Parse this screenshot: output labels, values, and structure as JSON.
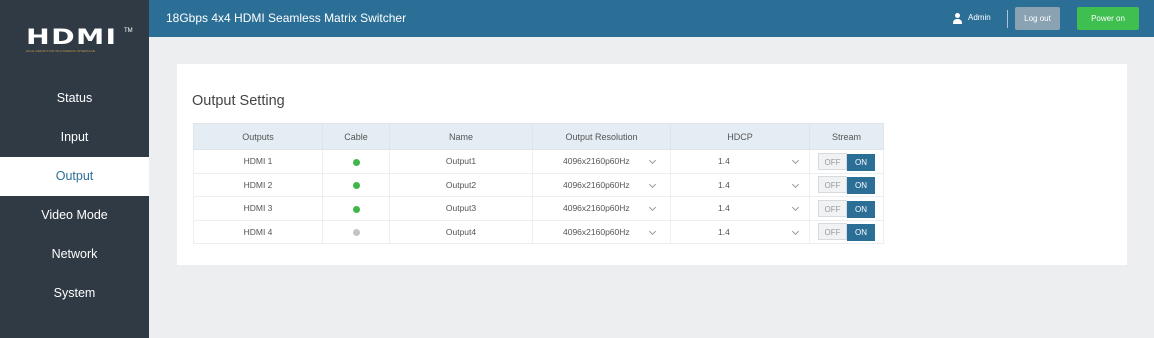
{
  "app": {
    "title": "18Gbps 4x4 HDMI Seamless Matrix Switcher",
    "logo_text": "HDMI",
    "logo_tm": "TM",
    "logo_sub": "HIGH-DEFINITION MULTIMEDIA INTERFACE"
  },
  "header": {
    "user_icon": "user-icon",
    "user_name": "Admin",
    "logout_label": "Log out",
    "power_label": "Power on",
    "colors": {
      "bar": "#2b6f97",
      "power": "#3fbf4f",
      "logout": "#8aa3b3"
    }
  },
  "sidebar": {
    "active": "Output",
    "items": [
      {
        "label": "Status"
      },
      {
        "label": "Input"
      },
      {
        "label": "Output"
      },
      {
        "label": "Video Mode"
      },
      {
        "label": "Network"
      },
      {
        "label": "System"
      }
    ]
  },
  "main": {
    "section_title": "Output Setting",
    "columns": [
      "Outputs",
      "Cable",
      "Name",
      "Output Resolution",
      "HDCP",
      "Stream"
    ],
    "rows": [
      {
        "output": "HDMI 1",
        "cable": "connected",
        "cable_color": "#3fb54a",
        "name": "Output1",
        "resolution": "4096x2160p60Hz",
        "hdcp": "1.4",
        "stream_off": "OFF",
        "stream_on": "ON",
        "stream_state": "ON"
      },
      {
        "output": "HDMI 2",
        "cable": "connected",
        "cable_color": "#3fb54a",
        "name": "Output2",
        "resolution": "4096x2160p60Hz",
        "hdcp": "1.4",
        "stream_off": "OFF",
        "stream_on": "ON",
        "stream_state": "ON"
      },
      {
        "output": "HDMI 3",
        "cable": "connected",
        "cable_color": "#3fb54a",
        "name": "Output3",
        "resolution": "4096x2160p60Hz",
        "hdcp": "1.4",
        "stream_off": "OFF",
        "stream_on": "ON",
        "stream_state": "ON"
      },
      {
        "output": "HDMI 4",
        "cable": "disconnected",
        "cable_color": "#c4c4c4",
        "name": "Output4",
        "resolution": "4096x2160p60Hz",
        "hdcp": "1.4",
        "stream_off": "OFF",
        "stream_on": "ON",
        "stream_state": "ON"
      }
    ]
  }
}
